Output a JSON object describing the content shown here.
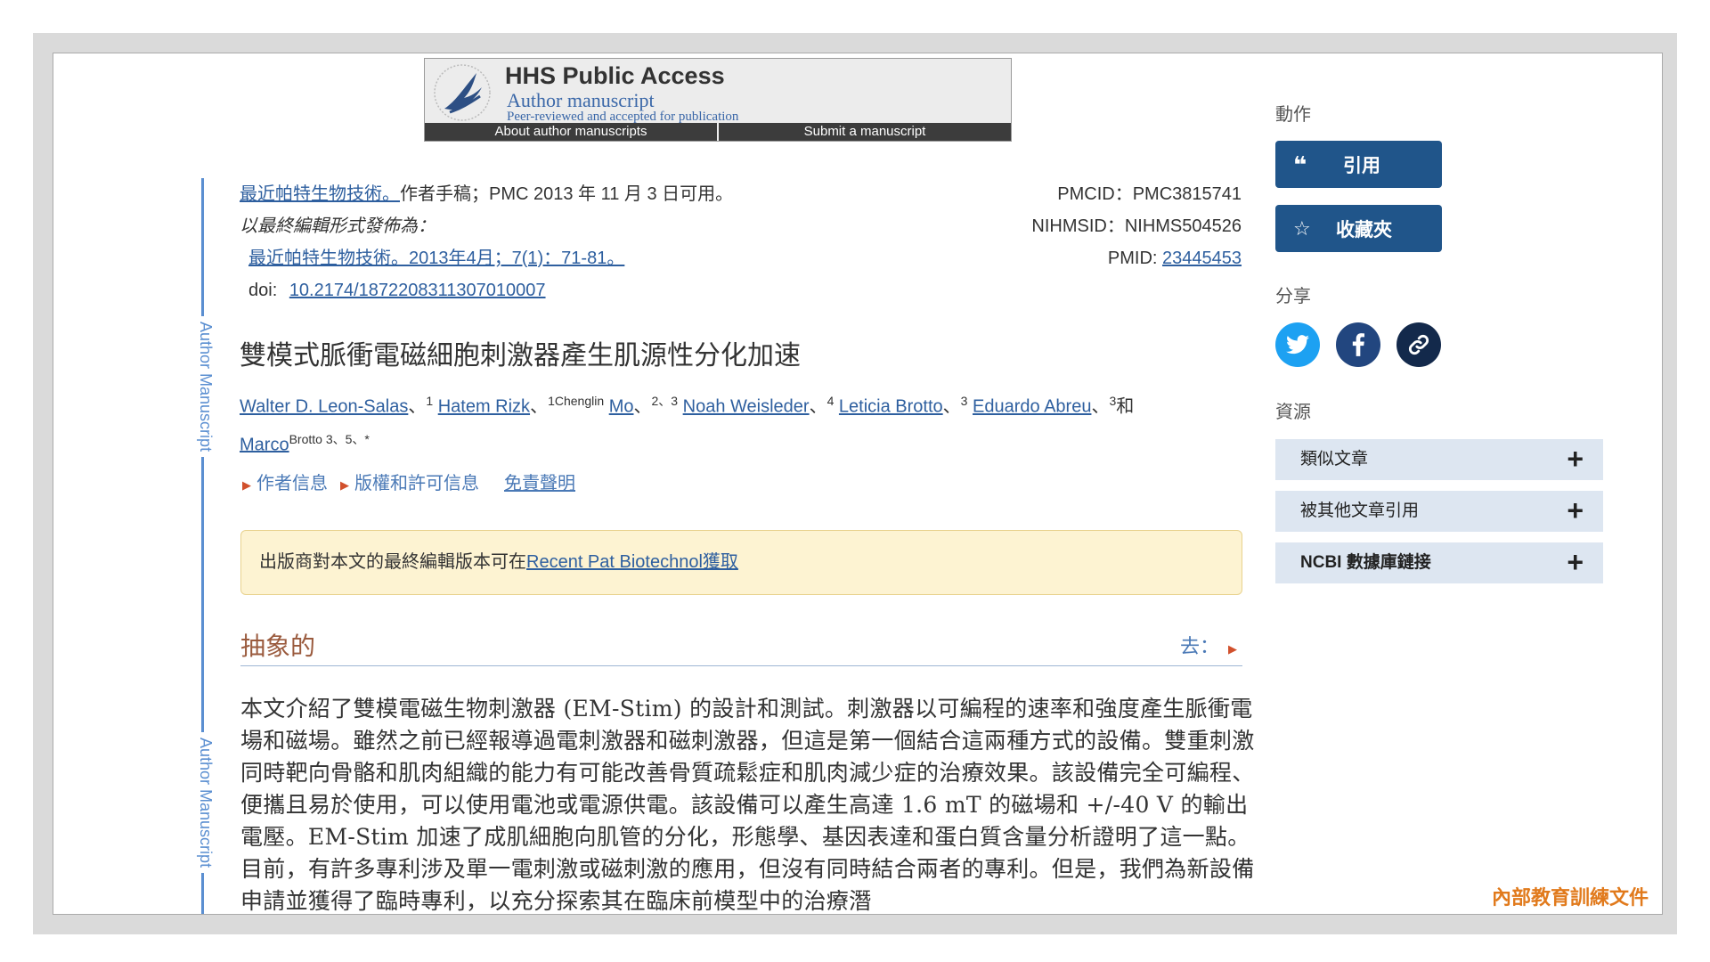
{
  "banner": {
    "title": "HHS Public Access",
    "subtitle": "Author manuscript",
    "tagline": "Peer-reviewed and accepted for publication",
    "about_link": "About author manuscripts",
    "submit_link": "Submit a manuscript"
  },
  "side_rule": {
    "label": "Author Manuscript"
  },
  "citation": {
    "journal_link": "最近帕特生物技術。",
    "availability": "作者手稿；PMC 2013 年 11 月 3 日可用。",
    "final_edited_label": "以最終編輯形式發佈為：",
    "final_citation": "最近帕特生物技術。2013年4月；7(1)：71-81。",
    "doi_label": "doi:",
    "doi": "10.2174/1872208311307010007",
    "pmcid": "PMCID：PMC3815741",
    "nihmsid": "NIHMSID：NIHMS504526",
    "pmid_label": "PMID:",
    "pmid": "23445453"
  },
  "article": {
    "title": "雙模式脈衝電磁細胞刺激器產生肌源性分化加速",
    "authors": [
      {
        "name": "Walter D. Leon-Salas",
        "aff": "1"
      },
      {
        "name": "Hatem Rizk",
        "aff": "1"
      },
      {
        "pre": "Chenglin",
        "name": "Mo",
        "aff": "2、3"
      },
      {
        "name": "Noah Weisleder",
        "aff": "4"
      },
      {
        "name": "Leticia Brotto",
        "aff": "3"
      },
      {
        "name": "Eduardo Abreu",
        "aff": "3"
      },
      {
        "name": "Marco",
        "post": "Brotto 3、5、*"
      }
    ],
    "and_word": "和",
    "author_info": "作者信息",
    "copyright_info": "版權和許可信息",
    "disclaimer": "免責聲明",
    "notice_text": "出版商對本文的最終編輯版本可在",
    "notice_link": "Recent Pat Biotechnol獲取",
    "section_heading": "抽象的",
    "goto_label": "去：",
    "abstract": "本文介紹了雙模電磁生物刺激器 (EM-Stim) 的設計和測試。刺激器以可編程的速率和強度產生脈衝電場和磁場。雖然之前已經報導過電刺激器和磁刺激器，但這是第一個結合這兩種方式的設備。雙重刺激同時靶向骨骼和肌肉組織的能力有可能改善骨質疏鬆症和肌肉減少症的治療效果。該設備完全可編程、便攜且易於使用，可以使用電池或電源供電。該設備可以產生高達 1.6 mT 的磁場和 +/-40 V 的輸出電壓。EM-Stim 加速了成肌細胞向肌管的分化，形態學、基因表達和蛋白質含量分析證明了這一點。目前，有許多專利涉及單一電刺激或磁刺激的應用，但沒有同時結合兩者的專利。但是，我們為新設備申請並獲得了臨時專利，以充分探索其在臨床前模型中的治療潛"
  },
  "sidebar": {
    "actions_label": "動作",
    "cite_button": "引用",
    "collections_button": "收藏夾",
    "share_label": "分享",
    "resources_label": "資源",
    "resources": [
      "類似文章",
      "被其他文章引用",
      "NCBI 數據庫鏈接"
    ]
  },
  "watermark": "內部教育訓練文件",
  "colors": {
    "link": "#2e5f9f",
    "button": "#20558a",
    "notice_bg": "#fdf3d2",
    "heading": "#9a5a3d",
    "twitter": "#1da1f2",
    "facebook": "#22467f",
    "link_share": "#13294b"
  }
}
